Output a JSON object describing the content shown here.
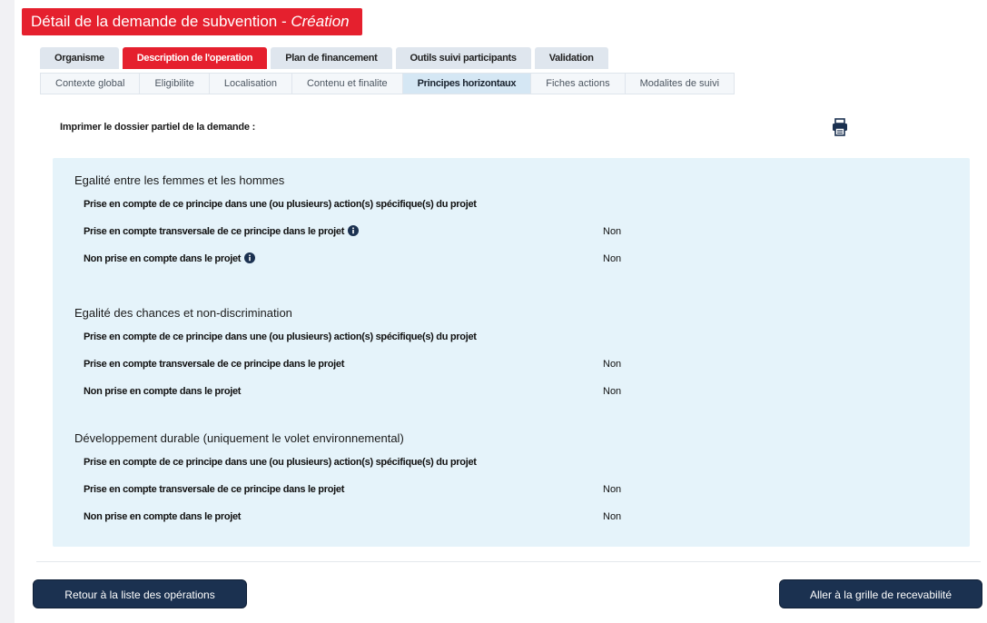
{
  "header": {
    "title": "Détail de la demande de subvention - ",
    "title_mode": "Création"
  },
  "tabs_primary": [
    {
      "label": "Organisme"
    },
    {
      "label": "Description de l'operation"
    },
    {
      "label": "Plan de financement"
    },
    {
      "label": "Outils suivi participants"
    },
    {
      "label": "Validation"
    }
  ],
  "tabs_secondary": [
    {
      "label": "Contexte global"
    },
    {
      "label": "Eligibilite"
    },
    {
      "label": "Localisation"
    },
    {
      "label": "Contenu et finalite"
    },
    {
      "label": "Principes horizontaux"
    },
    {
      "label": "Fiches actions"
    },
    {
      "label": "Modalites de suivi"
    }
  ],
  "print": {
    "label": "Imprimer le dossier partiel de la demande :",
    "icon": "print-icon"
  },
  "sections": [
    {
      "title": "Egalité entre les femmes et les hommes",
      "rows": [
        {
          "label": "Prise en compte de ce principe dans une (ou plusieurs) action(s) spécifique(s) du projet",
          "value": ""
        },
        {
          "label": "Prise en compte transversale de ce principe dans le projet",
          "value": "Non"
        },
        {
          "label": "Non prise en compte dans le projet",
          "value": "Non"
        }
      ]
    },
    {
      "title": "Egalité des chances et non-discrimination",
      "rows": [
        {
          "label": "Prise en compte de ce principe dans une (ou plusieurs) action(s) spécifique(s) du projet",
          "value": ""
        },
        {
          "label": "Prise en compte transversale de ce principe dans le projet",
          "value": "Non"
        },
        {
          "label": "Non prise en compte dans le projet",
          "value": "Non"
        }
      ]
    },
    {
      "title": "Développement durable (uniquement le volet environnemental)",
      "rows": [
        {
          "label": "Prise en compte de ce principe dans une (ou plusieurs) action(s) spécifique(s) du projet",
          "value": ""
        },
        {
          "label": "Prise en compte transversale de ce principe dans le projet",
          "value": "Non"
        },
        {
          "label": "Non prise en compte dans le projet",
          "value": "Non"
        }
      ]
    }
  ],
  "buttons": {
    "back": "Retour à la liste des opérations",
    "next": "Aller à la grille de recevabilité"
  },
  "colors": {
    "accent_red": "#e5202e",
    "panel_bg": "#e5f3fa",
    "button_bg": "#1b3150",
    "info_icon": "#1b3150"
  }
}
